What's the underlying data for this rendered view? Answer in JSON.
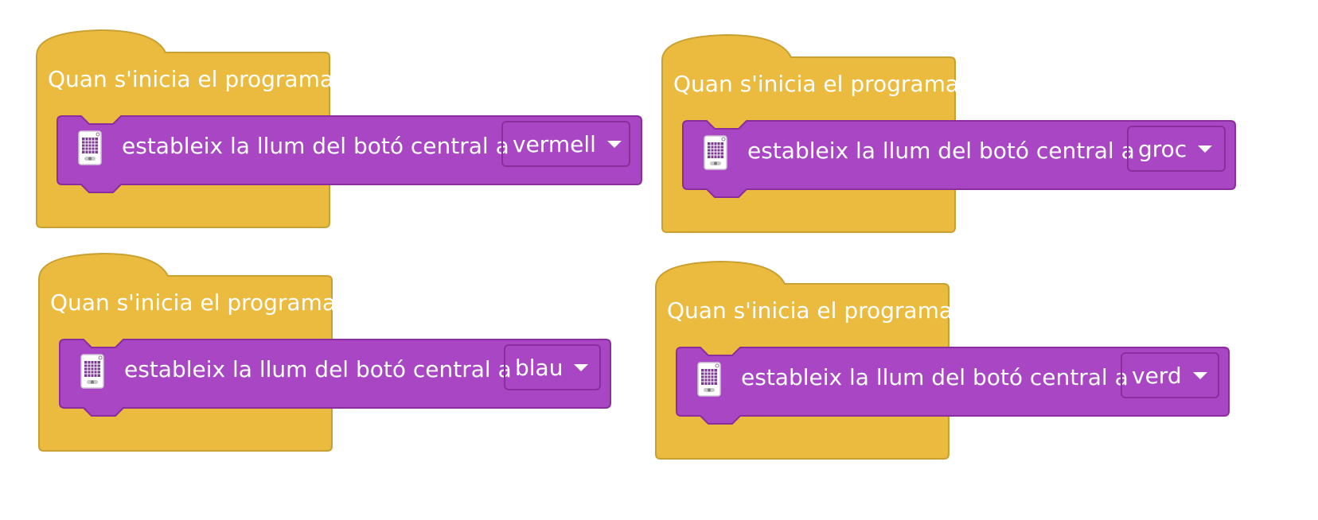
{
  "colors": {
    "event_block": "#ebbb3f",
    "event_block_border": "#c9a032",
    "action_block": "#a846c4",
    "action_block_border": "#8a2e9e"
  },
  "blocks": [
    {
      "hat_label": "Quan s'inicia el programa",
      "command_label": "estableix la llum del botó central a",
      "color_value": "vermell",
      "icon": "hub-icon",
      "dropdown_icon": "chevron-down-icon"
    },
    {
      "hat_label": "Quan s'inicia el programa",
      "command_label": "estableix la llum del botó central a",
      "color_value": "groc",
      "icon": "hub-icon",
      "dropdown_icon": "chevron-down-icon"
    },
    {
      "hat_label": "Quan s'inicia el programa",
      "command_label": "estableix la llum del botó central a",
      "color_value": "blau",
      "icon": "hub-icon",
      "dropdown_icon": "chevron-down-icon"
    },
    {
      "hat_label": "Quan s'inicia el programa",
      "command_label": "estableix la llum del botó central a",
      "color_value": "verd",
      "icon": "hub-icon",
      "dropdown_icon": "chevron-down-icon"
    }
  ]
}
